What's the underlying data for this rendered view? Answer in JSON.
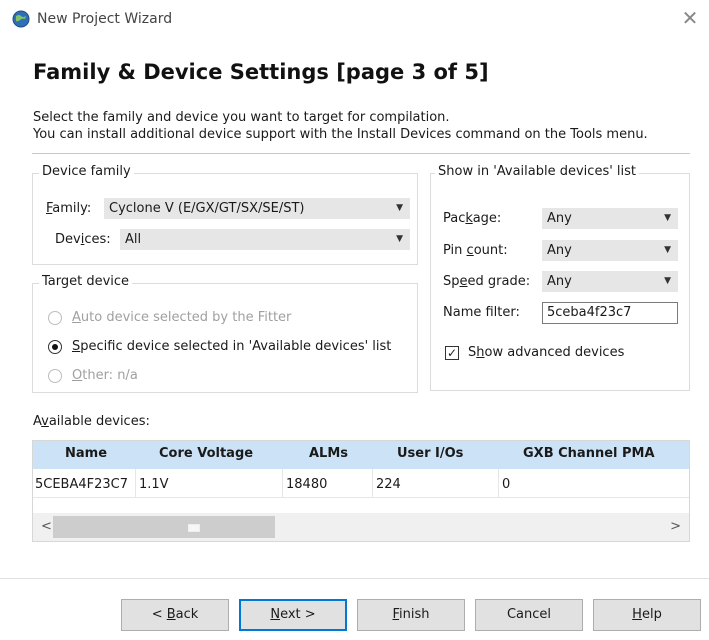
{
  "window": {
    "title": "New Project Wizard",
    "close_glyph": "✕",
    "icon": "globe-app-icon"
  },
  "page": {
    "heading": "Family & Device Settings [page 3 of 5]",
    "description_line1": "Select the family and device you want to target for compilation.",
    "description_line2": "You can install additional device support with the Install Devices command on the Tools menu."
  },
  "device_family": {
    "group_title": "Device family",
    "family_label_pre": "",
    "family_label_ul": "F",
    "family_label_post": "amily:",
    "family_value": "Cyclone V (E/GX/GT/SX/SE/ST)",
    "devices_label_pre": "Dev",
    "devices_label_ul": "i",
    "devices_label_post": "ces:",
    "devices_value": "All"
  },
  "target_device": {
    "group_title": "Target device",
    "auto_pre": "",
    "auto_ul": "A",
    "auto_post": "uto device selected by the Fitter",
    "specific_pre": "",
    "specific_ul": "S",
    "specific_post": "pecific device selected in 'Available devices' list",
    "other_pre": "",
    "other_ul": "O",
    "other_post": "ther:  n/a",
    "selected": "specific"
  },
  "show_in_list": {
    "group_title": "Show in 'Available devices' list",
    "package_pre": "Pac",
    "package_ul": "k",
    "package_post": "age:",
    "package_value": "Any",
    "pincount_pre": "Pin ",
    "pincount_ul": "c",
    "pincount_post": "ount:",
    "pincount_value": "Any",
    "speed_pre": "Sp",
    "speed_ul": "e",
    "speed_post": "ed grade:",
    "speed_value": "Any",
    "name_filter_label": "Name filter:",
    "name_filter_value": "5ceba4f23c7",
    "advanced_pre": "S",
    "advanced_ul": "h",
    "advanced_post": "ow advanced devices",
    "advanced_checked": true,
    "check_glyph": "✓"
  },
  "available_devices": {
    "label_pre": "A",
    "label_ul": "v",
    "label_post": "ailable devices:",
    "columns": [
      "Name",
      "Core Voltage",
      "ALMs",
      "User I/Os",
      "GXB Channel PMA"
    ],
    "rows": [
      [
        "5CEBA4F23C7",
        "1.1V",
        "18480",
        "224",
        "0"
      ]
    ],
    "scroll_left": "<",
    "scroll_right": ">"
  },
  "buttons": {
    "back_pre": "< ",
    "back_ul": "B",
    "back_post": "ack",
    "next_pre": "",
    "next_ul": "N",
    "next_post": "ext >",
    "finish_pre": "",
    "finish_ul": "F",
    "finish_post": "inish",
    "cancel": "Cancel",
    "help_pre": "",
    "help_ul": "H",
    "help_post": "elp"
  },
  "colors": {
    "table_header_bg": "#cce3f7",
    "default_button_border": "#0078d7"
  }
}
